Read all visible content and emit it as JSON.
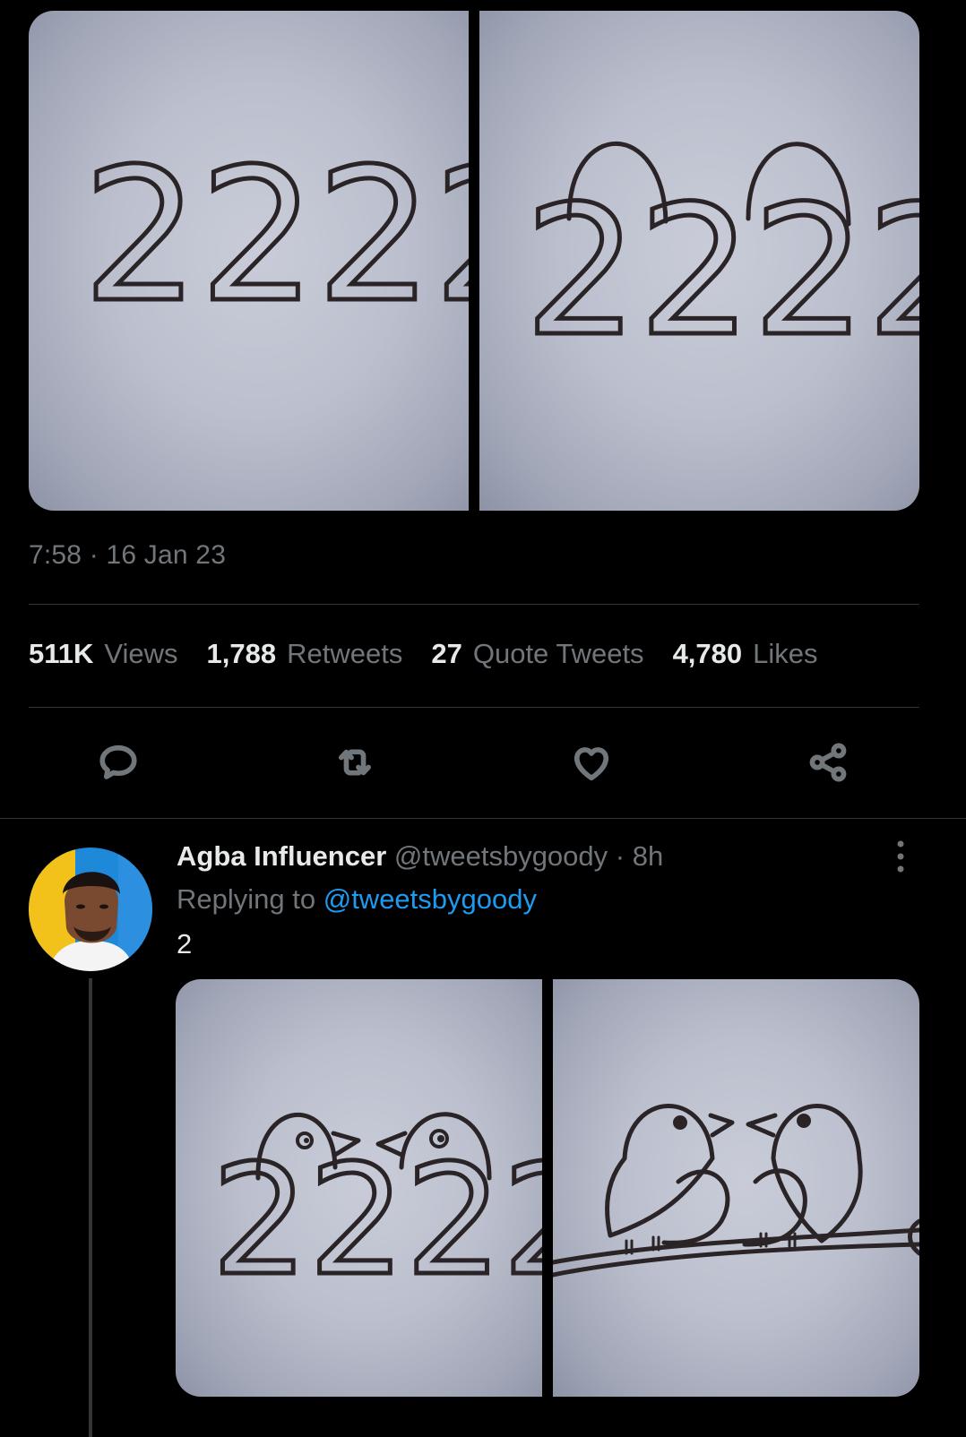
{
  "tweet": {
    "time": "7:58",
    "separator": "·",
    "date": "16 Jan 23",
    "stats": [
      {
        "count": "511K",
        "label": "Views"
      },
      {
        "count": "1,788",
        "label": "Retweets"
      },
      {
        "count": "27",
        "label": "Quote Tweets"
      },
      {
        "count": "4,780",
        "label": "Likes"
      }
    ],
    "actions": [
      "reply-icon",
      "retweet-icon",
      "like-icon",
      "share-icon"
    ],
    "images": [
      {
        "handwritten_text": "2222"
      },
      {
        "handwritten_text": "2222"
      }
    ]
  },
  "reply": {
    "name": "Agba Influencer",
    "handle": "@tweetsbygoody",
    "separator": "·",
    "age": "8h",
    "replying_prefix": "Replying to",
    "replying_to": "@tweetsbygoody",
    "text": "2",
    "images": [
      {
        "handwritten_text": "2222"
      },
      {
        "handwritten_text": "2222"
      }
    ]
  },
  "colors": {
    "background": "#000000",
    "primary_text": "#e7e9ea",
    "secondary_text": "#71767b",
    "link": "#1d9bf0",
    "divider": "#2f3336"
  }
}
